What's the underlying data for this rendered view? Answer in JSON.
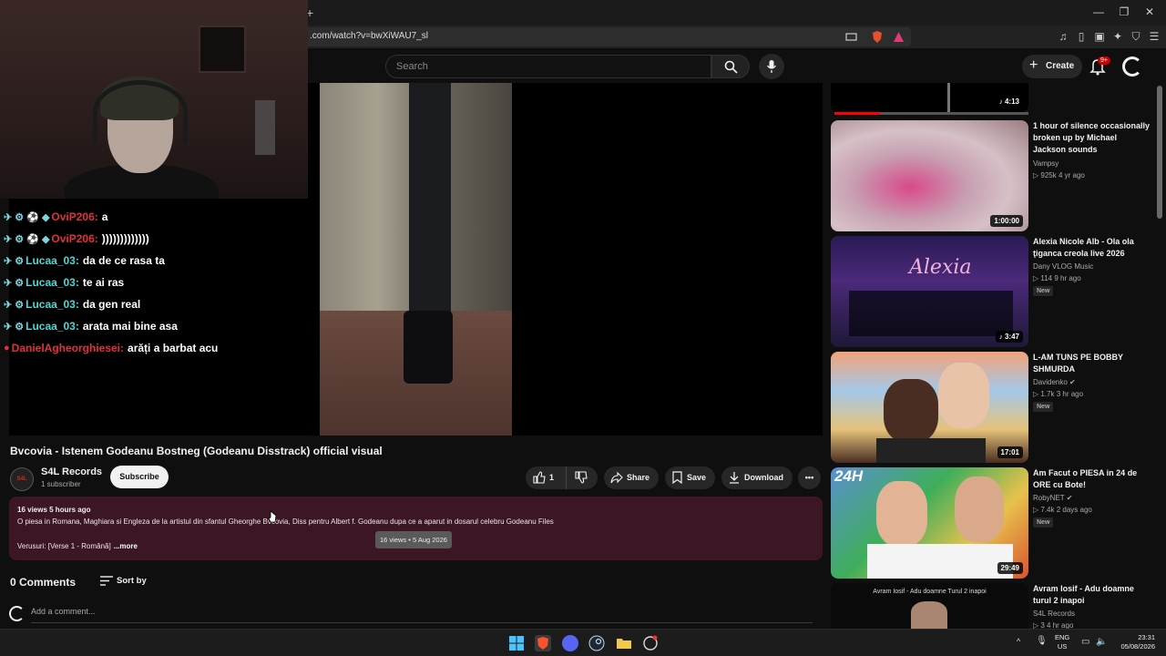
{
  "browser": {
    "new_tab_symbol": "+",
    "url": ".com/watch?v=bwXiWAU7_sl"
  },
  "header": {
    "search_placeholder": "Search",
    "create_label": "Create",
    "notification_count": "9+"
  },
  "chat": [
    {
      "user": "OviP206:",
      "message": "a",
      "color": "red"
    },
    {
      "user": "OviP206:",
      "message": ")))))))))))))",
      "color": "red"
    },
    {
      "user": "Lucaa_03:",
      "message": "da de ce rasa ta",
      "color": "cyan"
    },
    {
      "user": "Lucaa_03:",
      "message": "te ai ras",
      "color": "cyan"
    },
    {
      "user": "Lucaa_03:",
      "message": "da gen real",
      "color": "cyan"
    },
    {
      "user": "Lucaa_03:",
      "message": "arata mai bine asa",
      "color": "cyan"
    },
    {
      "user": "DanielAgheorghiesei:",
      "message": "arăți a barbat acu",
      "color": "red"
    }
  ],
  "video": {
    "title": "Bvcovia - Istenem Godeanu Bostneg (Godeanu Disstrack) official visual",
    "channel": "S4L Records",
    "subscribers": "1 subscriber",
    "subscribe_label": "Subscribe",
    "likes": "1",
    "share_label": "Share",
    "save_label": "Save",
    "download_label": "Download"
  },
  "description": {
    "meta": "16 views  5 hours ago",
    "text": "O piesa in Romana, Maghiara si Engleza de la artistul din sfantul Gheorghe Bvcovia, Diss pentru Albert f. Godeanu dupa ce a aparut in dosarul celebru Godeanu Files",
    "verse": "Verusuri: [Verse 1 - Română]",
    "more_label": "...more",
    "tooltip": "16 views • 5 Aug 2026"
  },
  "comments": {
    "count_label": "0 Comments",
    "sort_label": "Sort by",
    "placeholder": "Add a comment..."
  },
  "sidebar": [
    {
      "duration": "4:13"
    },
    {
      "title": "1 hour of silence occasionally broken up by Michael Jackson sounds",
      "channel": "Vampsy",
      "views": "▷ 925k   4 yr ago",
      "duration": "1:00:00"
    },
    {
      "title": "Alexia Nicole Alb - Ola ola ţiganca creola live 2026",
      "channel": "Dany VLOG Music",
      "views": "▷ 114   9 hr ago",
      "badge": "New",
      "duration": "3:47"
    },
    {
      "title": "L-AM TUNS PE BOBBY SHMURDA",
      "channel": "Davidenko",
      "views": "▷ 1.7k   3 hr ago",
      "badge": "New",
      "duration": "17:01"
    },
    {
      "title": "Am Facut o PIESA in 24 de ORE cu Bote!",
      "channel": "RobyNET",
      "views": "▷ 7.4k   2 days ago",
      "badge": "New",
      "duration": "29:49"
    },
    {
      "title": "Avram Iosif - Adu doamne turul 2 inapoi",
      "channel": "S4L Records",
      "views": "▷ 3   4 hr ago",
      "thumb_text": "Avram Iosif - Adu doamne Turul 2 inapoi"
    }
  ],
  "thumb_text_24h": "24H",
  "thumb_text_alexia": "Alexia",
  "taskbar": {
    "lang": "ENG",
    "region": "US",
    "time": "23:31",
    "date": "05/08/2026"
  }
}
